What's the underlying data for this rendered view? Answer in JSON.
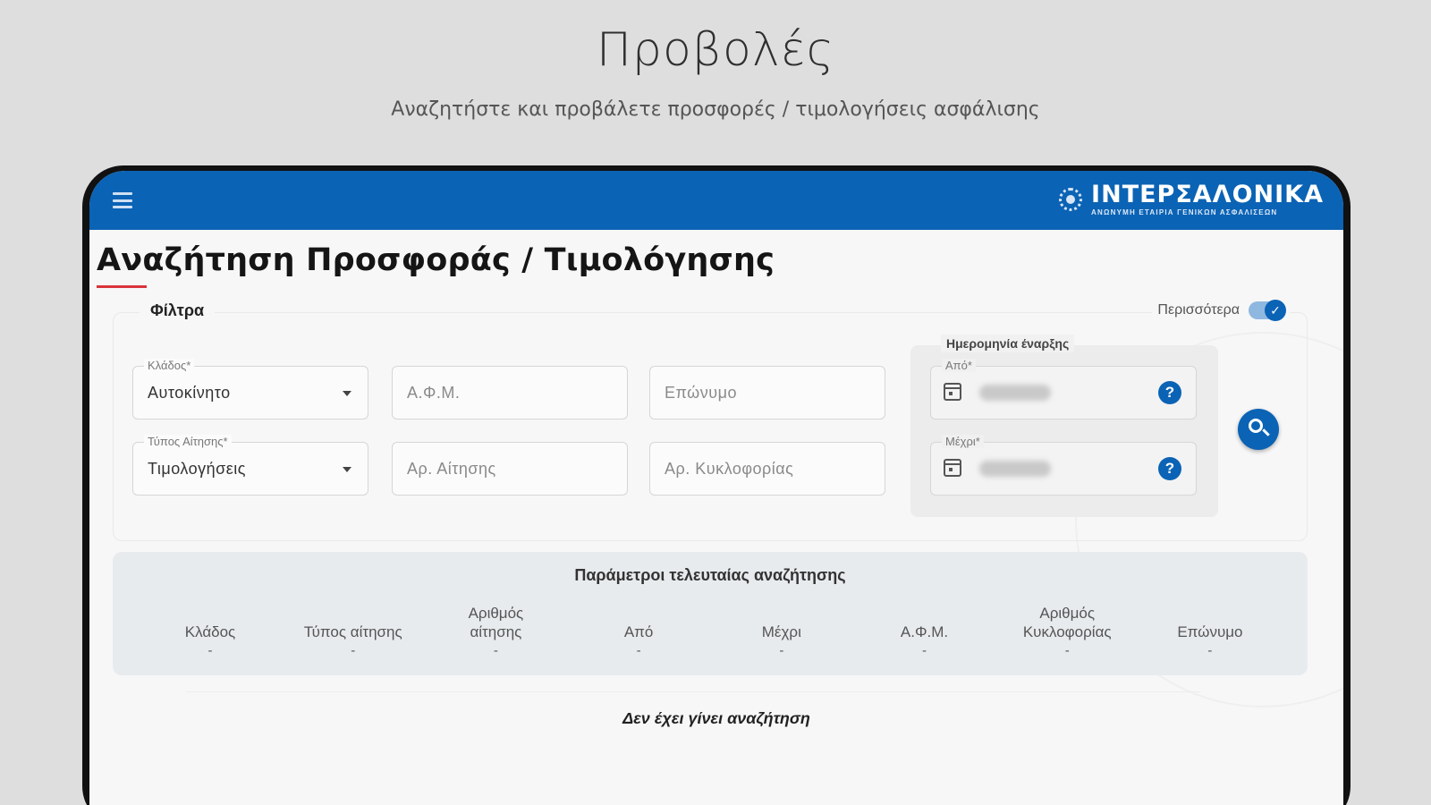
{
  "promo": {
    "title": "Προβολές",
    "subtitle": "Αναζητήστε και προβάλετε προσφορές / τιμολογήσεις ασφάλισης"
  },
  "header": {
    "brand_name": "ΙΝΤΕΡΣΑΛΟΝΙΚΑ",
    "brand_tagline": "ΑΝΩΝΥΜΗ ΕΤΑΙΡΙΑ ΓΕΝΙΚΩΝ ΑΣΦΑΛΙΣΕΩΝ",
    "menu_icon": "hamburger-menu-icon",
    "color": "#0b63b5"
  },
  "page": {
    "title": "Αναζήτηση Προσφοράς / Τιμολόγησης",
    "accent_color": "#d9343a"
  },
  "filters": {
    "legend": "Φίλτρα",
    "more_toggle": {
      "label": "Περισσότερα",
      "checked": true
    },
    "branch": {
      "label": "Κλάδος*",
      "value": "Αυτοκίνητο"
    },
    "request_type": {
      "label": "Τύπος Αίτησης*",
      "value": "Τιμολογήσεις"
    },
    "afm": {
      "placeholder": "Α.Φ.Μ."
    },
    "surname": {
      "placeholder": "Επώνυμο"
    },
    "request_no": {
      "placeholder": "Αρ. Αίτησης"
    },
    "plate_no": {
      "placeholder": "Αρ. Κυκλοφορίας"
    },
    "start_date": {
      "group_label": "Ημερομηνία έναρξης",
      "from_label": "Από*",
      "to_label": "Μέχρι*"
    },
    "search_icon": "magnifier-icon"
  },
  "last_search": {
    "title": "Παράμετροι τελευταίας αναζήτησης",
    "columns": [
      {
        "label": "Κλάδος",
        "value": "-"
      },
      {
        "label": "Τύπος αίτησης",
        "value": "-"
      },
      {
        "label": "Αριθμός αίτησης",
        "value": "-"
      },
      {
        "label": "Από",
        "value": "-"
      },
      {
        "label": "Μέχρι",
        "value": "-"
      },
      {
        "label": "Α.Φ.Μ.",
        "value": "-"
      },
      {
        "label": "Αριθμός Κυκλοφορίας",
        "value": "-"
      },
      {
        "label": "Επώνυμο",
        "value": "-"
      }
    ]
  },
  "results": {
    "empty_message": "Δεν έχει γίνει αναζήτηση"
  }
}
